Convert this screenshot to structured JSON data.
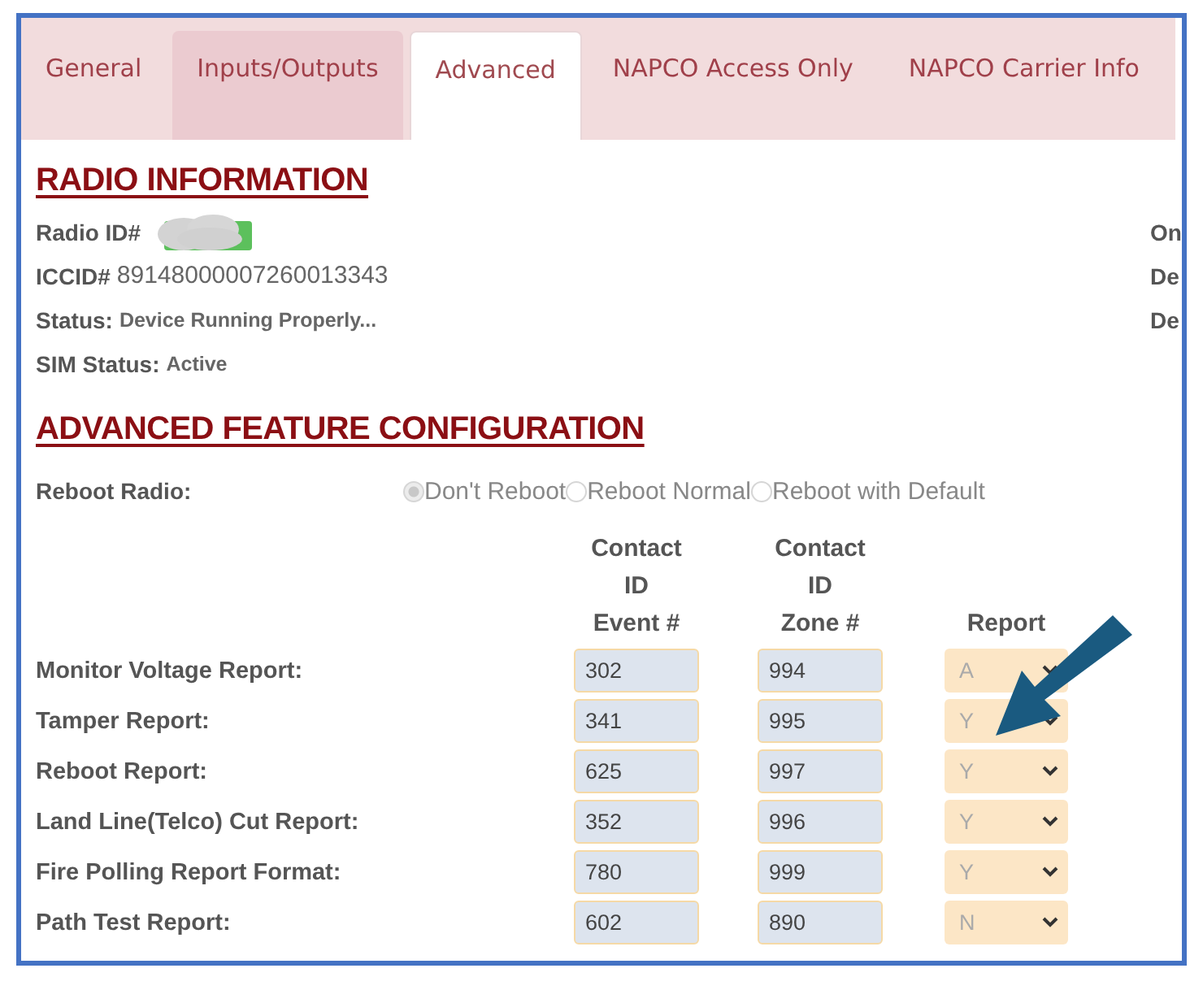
{
  "tabs": [
    {
      "label": "General",
      "selected": false,
      "highlighted": false
    },
    {
      "label": "Inputs/Outputs",
      "selected": false,
      "highlighted": true
    },
    {
      "label": "Advanced",
      "selected": true,
      "highlighted": false
    },
    {
      "label": "NAPCO Access Only",
      "selected": false,
      "highlighted": false
    },
    {
      "label": "NAPCO Carrier Info",
      "selected": false,
      "highlighted": false
    }
  ],
  "radio_information": {
    "title": "RADIO INFORMATION",
    "rows": [
      {
        "label": "Radio ID#",
        "kind": "redacted"
      },
      {
        "label": "ICCID#",
        "value": "89148000007260013343",
        "kind": "large"
      },
      {
        "label": "Status:",
        "value": "Device Running Properly...",
        "kind": "small"
      },
      {
        "label": "SIM Status:",
        "value": "Active",
        "kind": "small"
      }
    ],
    "right_column": [
      "On",
      "De",
      "De"
    ]
  },
  "advanced": {
    "title": "ADVANCED FEATURE CONFIGURATION",
    "reboot": {
      "label": "Reboot Radio:",
      "disabled": true,
      "options": [
        {
          "label": "Don't Reboot",
          "selected": true
        },
        {
          "label": "Reboot Normal",
          "selected": false
        },
        {
          "label": "Reboot with Default",
          "selected": false
        }
      ]
    },
    "columns": [
      [
        "Contact",
        "ID",
        "Event #"
      ],
      [
        "Contact",
        "ID",
        "Zone #"
      ],
      [
        "Report"
      ]
    ],
    "rows": [
      {
        "label": "Monitor Voltage Report:",
        "event": "302",
        "zone": "994",
        "report": "A"
      },
      {
        "label": "Tamper Report:",
        "event": "341",
        "zone": "995",
        "report": "Y"
      },
      {
        "label": "Reboot Report:",
        "event": "625",
        "zone": "997",
        "report": "Y"
      },
      {
        "label": "Land Line(Telco) Cut Report:",
        "event": "352",
        "zone": "996",
        "report": "Y"
      },
      {
        "label": "Fire Polling Report Format:",
        "event": "780",
        "zone": "999",
        "report": "Y"
      },
      {
        "label": "Path Test Report:",
        "event": "602",
        "zone": "890",
        "report": "N"
      }
    ]
  }
}
